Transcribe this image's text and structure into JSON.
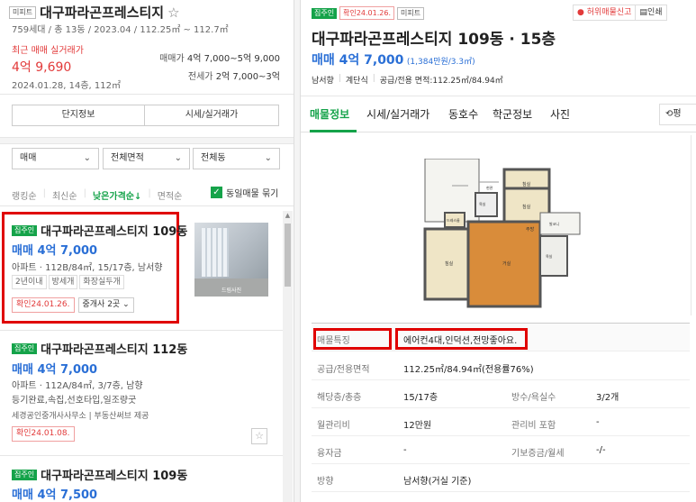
{
  "left": {
    "badge": "미피트",
    "complex_title": "대구파라곤프레스티지",
    "star_glyph": "☆",
    "summary": "759세대 / 총 13동 / 2023.04 / 112.25㎡ ~ 112.7㎡",
    "recent_label": "최근 매매 실거래가",
    "recent_price": "4억 9,690",
    "recent_detail": "2024.01.28, 14층, 112㎡",
    "sale_label": "매매가",
    "sale_value": "4억 7,000~5억 9,000",
    "jeonse_label": "전세가",
    "jeonse_value": "2억 7,000~3억",
    "btn_info": "단지정보",
    "btn_price": "시세/실거래가",
    "filters": [
      "매매",
      "전체면적",
      "전체동"
    ],
    "sorts": [
      "랭킹순",
      "최신순",
      "낮은가격순↓",
      "면적순"
    ],
    "same_toggle": "동일매물 묶기",
    "listings": [
      {
        "badge": "집주인",
        "title": "대구파라곤프레스티지 109동",
        "price": "매매 4억 7,000",
        "detail": "아파트 · 112B/84㎡, 15/17층, 남서향",
        "tags": [
          "2년이내",
          "방세개",
          "화장실두개"
        ],
        "confirm": "확인24.01.26.",
        "agent": "중개사 2곳"
      },
      {
        "badge": "집주인",
        "title": "대구파라곤프레스티지 112동",
        "price": "매매 4억 7,000",
        "detail": "아파트 · 112A/84㎡, 3/7층, 남향",
        "detail2": "등기완료,속집,선호타입,일조량굿",
        "agency": "세경공인중개사사무소 | 부동산써브 제공",
        "confirm": "확인24.01.08."
      },
      {
        "badge": "집주인",
        "title": "대구파라곤프레스티지 109동",
        "price": "매매 4억 7,500"
      }
    ],
    "photo_caption": "드림사진"
  },
  "right": {
    "badge_owner": "집주인",
    "confirm": "확인24.01.26.",
    "badge_apt": "미피트",
    "report_label": "허위매물신고",
    "print_label": "인쇄",
    "title": "대구파라곤프레스티지 109동 · 15층",
    "price": "매매 4억 7,000",
    "price_sub": "(1,384만원/3.3㎡)",
    "facts": [
      "남서향",
      "계단식",
      "공급/전용 면적:112.25㎡/84.94㎡"
    ],
    "tabs": [
      "매물정보",
      "시세/실거래가",
      "동호수",
      "학군정보",
      "사진"
    ],
    "tab_extra": "평",
    "rows": [
      {
        "k": "매물특징",
        "v": "에어컨4대,인덕션,전망좋아요."
      },
      {
        "k": "공급/전용면적",
        "v": "112.25㎡/84.94㎡(전용률76%)"
      },
      {
        "k": "해당층/총층",
        "v": "15/17층",
        "k2": "방수/욕실수",
        "v2": "3/2개"
      },
      {
        "k": "월관리비",
        "v": "12만원",
        "k2": "관리비 포함",
        "v2": "-"
      },
      {
        "k": "융자금",
        "v": "-",
        "k2": "기보증금/월세",
        "v2": "-/-"
      },
      {
        "k": "방향",
        "v": "남서향(거실 기준)"
      }
    ],
    "floor_rooms": [
      "침실",
      "침실",
      "침실",
      "거실",
      "주방",
      "드레스룸",
      "욕실",
      "욕실",
      "현관",
      "발코니"
    ]
  },
  "colors": {
    "accent_blue": "#2a6fd6",
    "accent_green": "#15a34a",
    "highlight_red": "#e00000"
  }
}
